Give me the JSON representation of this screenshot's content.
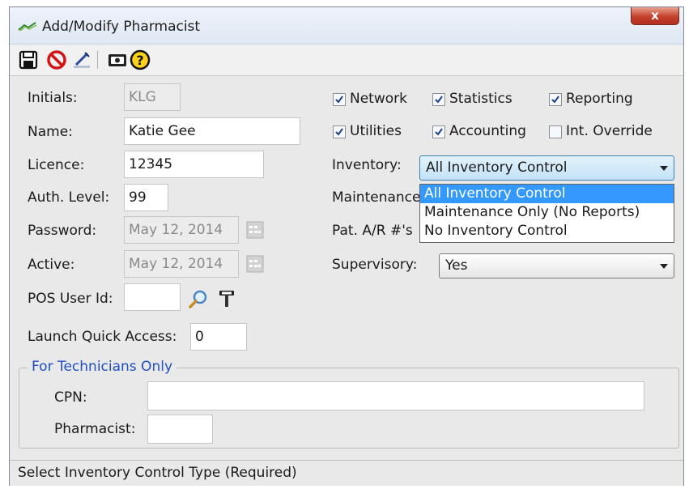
{
  "window": {
    "title": "Add/Modify Pharmacist",
    "close_label": "x"
  },
  "toolbar": {
    "save": "save-icon",
    "cancel": "cancel-icon",
    "edit": "edit-icon",
    "card": "card-icon",
    "help": "help-icon"
  },
  "form": {
    "initials_label": "Initials:",
    "initials_value": "KLG",
    "name_label": "Name:",
    "name_value": "Katie Gee",
    "licence_label": "Licence:",
    "licence_value": "12345",
    "auth_label": "Auth. Level:",
    "auth_value": "99",
    "password_label": "Password:",
    "password_value": "May 12, 2014",
    "active_label": "Active:",
    "active_value": "May 12, 2014",
    "pos_label": "POS User Id:",
    "pos_value": "",
    "launch_label": "Launch Quick Access:",
    "launch_value": "0"
  },
  "permissions": [
    {
      "label": "Network",
      "checked": true
    },
    {
      "label": "Statistics",
      "checked": true
    },
    {
      "label": "Reporting",
      "checked": true
    },
    {
      "label": "Utilities",
      "checked": true
    },
    {
      "label": "Accounting",
      "checked": true
    },
    {
      "label": "Int. Override",
      "checked": false
    }
  ],
  "inventory": {
    "label": "Inventory:",
    "value": "All Inventory Control",
    "options": [
      "All Inventory Control",
      "Maintenance Only (No Reports)",
      "No Inventory Control"
    ]
  },
  "maintenance_label": "Maintenance",
  "patar_label": "Pat. A/R #'s",
  "supervisory": {
    "label": "Supervisory:",
    "value": "Yes"
  },
  "technicians": {
    "title": "For Technicians Only",
    "cpn_label": "CPN:",
    "cpn_value": "",
    "pharmacist_label": "Pharmacist:",
    "pharmacist_value": ""
  },
  "status": "Select Inventory Control Type (Required)",
  "colors": {
    "accent": "#3399ff",
    "group_title": "#1e4fc0",
    "close": "#c4402b"
  }
}
